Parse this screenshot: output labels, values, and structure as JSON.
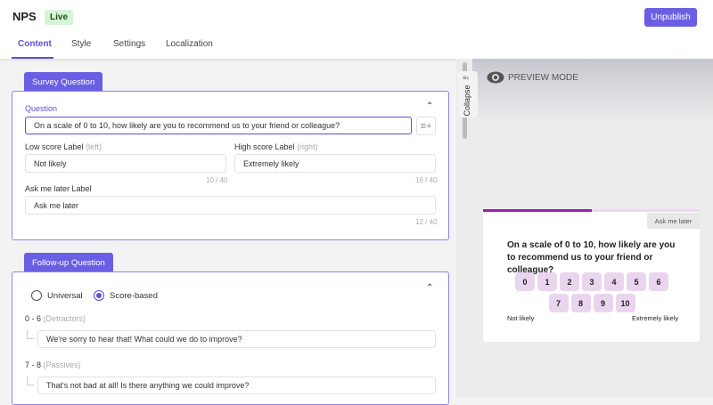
{
  "header": {
    "title": "NPS",
    "status": "Live",
    "unpublish": "Unpublish",
    "tabs": [
      "Content",
      "Style",
      "Settings",
      "Localization"
    ]
  },
  "survey": {
    "tab": "Survey Question",
    "question_label": "Question",
    "question_value": "On a scale of 0 to 10, how likely are you to recommend us to your friend or colleague?",
    "low_label": "Low score Label",
    "low_hint": "(left)",
    "low_value": "Not likely",
    "low_count": "10 / 40",
    "high_label": "High score Label",
    "high_hint": "(right)",
    "high_value": "Extremely likely",
    "high_count": "16 / 40",
    "ask_label": "Ask me later Label",
    "ask_value": "Ask me later",
    "ask_count": "12 / 40"
  },
  "followup": {
    "tab": "Follow-up Question",
    "radio_universal": "Universal",
    "radio_score": "Score-based",
    "selected": "Score-based",
    "groups": [
      {
        "range": "0 - 6",
        "name": "(Detractors)",
        "value": "We're sorry to hear that! What could we do to improve?"
      },
      {
        "range": "7 - 8",
        "name": "(Passives)",
        "value": "That's not bad at all! Is there anything we could improve?"
      }
    ]
  },
  "preview": {
    "mode": "PREVIEW MODE",
    "collapse": "Collapse",
    "ask_later": "Ask me later",
    "progress": 0.5,
    "question": "On a scale of 0 to 10, how likely are you to recommend us to your friend or colleague?",
    "scores": [
      "0",
      "1",
      "2",
      "3",
      "4",
      "5",
      "6",
      "7",
      "8",
      "9",
      "10"
    ],
    "low": "Not likely",
    "high": "Extremely likely"
  },
  "colors": {
    "accent": "#6a5fe3",
    "progress": "#9b1fb5",
    "score_bg": "#ead5ee"
  }
}
